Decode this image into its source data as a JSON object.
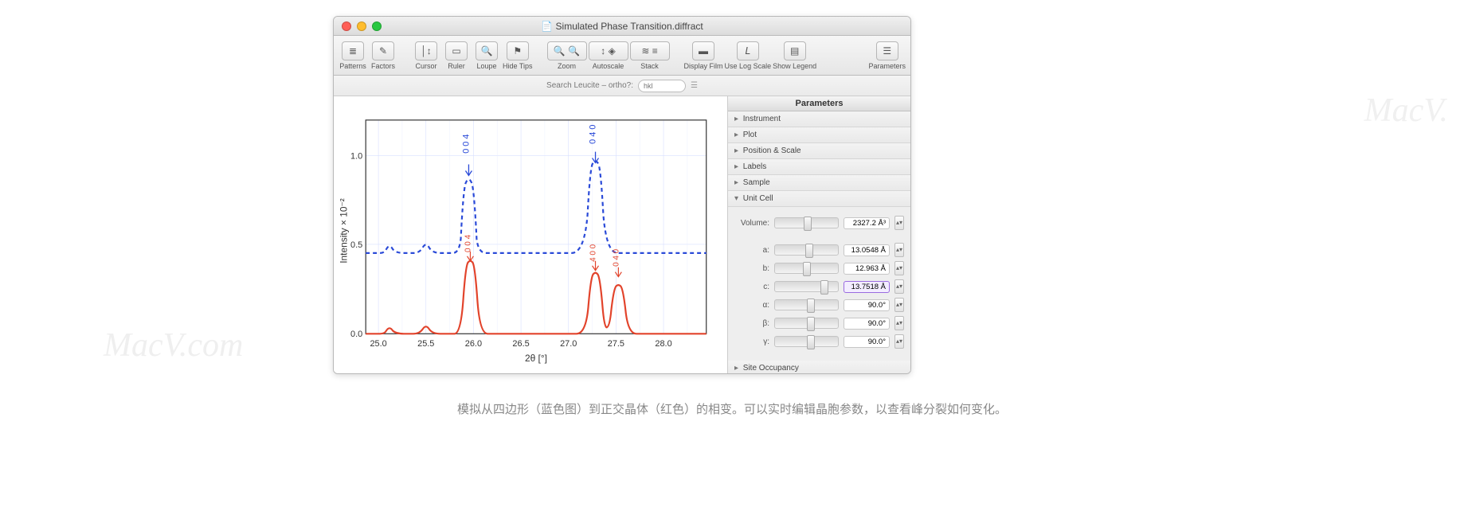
{
  "window": {
    "title": "Simulated Phase Transition.diffract"
  },
  "toolbar": {
    "patterns": "Patterns",
    "factors": "Factors",
    "cursor": "Cursor",
    "ruler": "Ruler",
    "loupe": "Loupe",
    "hidetips": "Hide Tips",
    "zoom": "Zoom",
    "autoscale": "Autoscale",
    "stack": "Stack",
    "display": "Display Film",
    "uselog": "Use Log Scale",
    "legend": "Show Legend",
    "params": "Parameters"
  },
  "search": {
    "label": "Search Leucite – ortho?:",
    "placeholder": "hkl"
  },
  "side": {
    "header": "Parameters",
    "sections": {
      "instrument": "Instrument",
      "plot": "Plot",
      "posscale": "Position & Scale",
      "labels": "Labels",
      "sample": "Sample",
      "unitcell": "Unit Cell",
      "siteocc": "Site Occupancy"
    },
    "unitcell": {
      "volume": {
        "label": "Volume:",
        "value": "2327.2 Å³",
        "pos": 45
      },
      "a": {
        "label": "a:",
        "value": "13.0548 Å",
        "pos": 48
      },
      "b": {
        "label": "b:",
        "value": "12.963 Å",
        "pos": 44
      },
      "c": {
        "label": "c:",
        "value": "13.7518 Å",
        "pos": 72,
        "hi": true
      },
      "alpha": {
        "label": "α:",
        "value": "90.0°",
        "pos": 50
      },
      "beta": {
        "label": "β:",
        "value": "90.0°",
        "pos": 50
      },
      "gamma": {
        "label": "γ:",
        "value": "90.0°",
        "pos": 50
      }
    }
  },
  "axis": {
    "ylabel": "Intensity × 10⁻²",
    "xlabel": "2θ [°]",
    "yticks": [
      "0.0",
      "0.5",
      "1.0"
    ],
    "xticks": [
      "25.0",
      "25.5",
      "26.0",
      "26.5",
      "27.0",
      "27.5",
      "28.0"
    ]
  },
  "peaks": {
    "blue": [
      "0 0 4",
      "0 4 0"
    ],
    "red": [
      "0 0 4",
      "4 0 0",
      "0 4 0"
    ]
  },
  "chart_data": {
    "type": "line",
    "title": "",
    "xlabel": "2θ [°]",
    "ylabel": "Intensity × 10⁻²",
    "xlim": [
      24.7,
      28.3
    ],
    "ylim": [
      0,
      1.2
    ],
    "series": [
      {
        "name": "tetragonal (blue, dashed)",
        "style": "dashed",
        "color": "#2a4ad8",
        "baseline": 0.45,
        "peaks": [
          {
            "label": "0 0 4",
            "x": 25.9,
            "height": 0.85
          },
          {
            "label": "0 4 0",
            "x": 27.3,
            "height": 0.95
          }
        ],
        "minor_bumps_x": [
          25.05,
          25.45
        ]
      },
      {
        "name": "orthorhombic (red, solid)",
        "style": "solid",
        "color": "#e2432b",
        "baseline": 0.0,
        "peaks": [
          {
            "label": "0 0 4",
            "x": 25.92,
            "height": 0.4
          },
          {
            "label": "4 0 0",
            "x": 27.3,
            "height": 0.33
          },
          {
            "label": "0 4 0",
            "x": 27.52,
            "height": 0.27
          }
        ],
        "minor_bumps_x": [
          25.05,
          25.45
        ]
      }
    ]
  },
  "caption": "模拟从四边形（蓝色图）到正交晶体（红色）的相变。可以实时编辑晶胞参数，以查看峰分裂如何变化。",
  "watermarks": {
    "right": "MacV.",
    "left": "MacV.com"
  }
}
